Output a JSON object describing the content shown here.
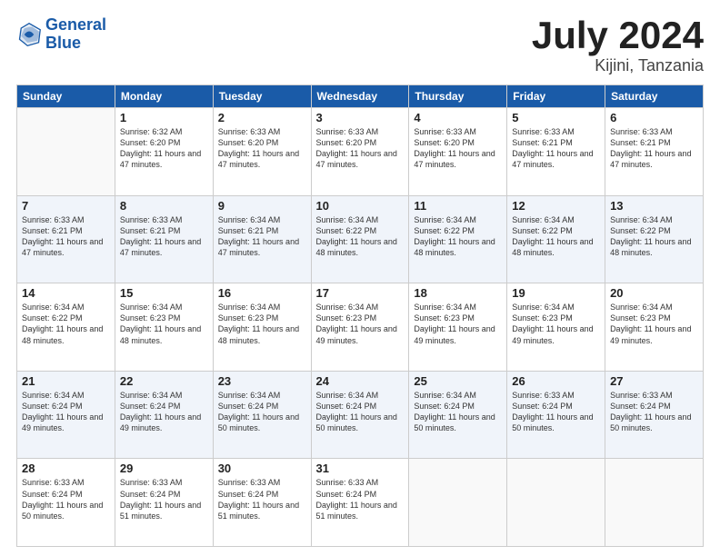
{
  "header": {
    "logo_line1": "General",
    "logo_line2": "Blue",
    "main_title": "July 2024",
    "sub_title": "Kijini, Tanzania"
  },
  "columns": [
    "Sunday",
    "Monday",
    "Tuesday",
    "Wednesday",
    "Thursday",
    "Friday",
    "Saturday"
  ],
  "weeks": [
    {
      "shade": "white",
      "days": [
        {
          "num": "",
          "info": ""
        },
        {
          "num": "1",
          "info": "Sunrise: 6:32 AM\nSunset: 6:20 PM\nDaylight: 11 hours\nand 47 minutes."
        },
        {
          "num": "2",
          "info": "Sunrise: 6:33 AM\nSunset: 6:20 PM\nDaylight: 11 hours\nand 47 minutes."
        },
        {
          "num": "3",
          "info": "Sunrise: 6:33 AM\nSunset: 6:20 PM\nDaylight: 11 hours\nand 47 minutes."
        },
        {
          "num": "4",
          "info": "Sunrise: 6:33 AM\nSunset: 6:20 PM\nDaylight: 11 hours\nand 47 minutes."
        },
        {
          "num": "5",
          "info": "Sunrise: 6:33 AM\nSunset: 6:21 PM\nDaylight: 11 hours\nand 47 minutes."
        },
        {
          "num": "6",
          "info": "Sunrise: 6:33 AM\nSunset: 6:21 PM\nDaylight: 11 hours\nand 47 minutes."
        }
      ]
    },
    {
      "shade": "shade",
      "days": [
        {
          "num": "7",
          "info": "Sunrise: 6:33 AM\nSunset: 6:21 PM\nDaylight: 11 hours\nand 47 minutes."
        },
        {
          "num": "8",
          "info": "Sunrise: 6:33 AM\nSunset: 6:21 PM\nDaylight: 11 hours\nand 47 minutes."
        },
        {
          "num": "9",
          "info": "Sunrise: 6:34 AM\nSunset: 6:21 PM\nDaylight: 11 hours\nand 47 minutes."
        },
        {
          "num": "10",
          "info": "Sunrise: 6:34 AM\nSunset: 6:22 PM\nDaylight: 11 hours\nand 48 minutes."
        },
        {
          "num": "11",
          "info": "Sunrise: 6:34 AM\nSunset: 6:22 PM\nDaylight: 11 hours\nand 48 minutes."
        },
        {
          "num": "12",
          "info": "Sunrise: 6:34 AM\nSunset: 6:22 PM\nDaylight: 11 hours\nand 48 minutes."
        },
        {
          "num": "13",
          "info": "Sunrise: 6:34 AM\nSunset: 6:22 PM\nDaylight: 11 hours\nand 48 minutes."
        }
      ]
    },
    {
      "shade": "white",
      "days": [
        {
          "num": "14",
          "info": "Sunrise: 6:34 AM\nSunset: 6:22 PM\nDaylight: 11 hours\nand 48 minutes."
        },
        {
          "num": "15",
          "info": "Sunrise: 6:34 AM\nSunset: 6:23 PM\nDaylight: 11 hours\nand 48 minutes."
        },
        {
          "num": "16",
          "info": "Sunrise: 6:34 AM\nSunset: 6:23 PM\nDaylight: 11 hours\nand 48 minutes."
        },
        {
          "num": "17",
          "info": "Sunrise: 6:34 AM\nSunset: 6:23 PM\nDaylight: 11 hours\nand 49 minutes."
        },
        {
          "num": "18",
          "info": "Sunrise: 6:34 AM\nSunset: 6:23 PM\nDaylight: 11 hours\nand 49 minutes."
        },
        {
          "num": "19",
          "info": "Sunrise: 6:34 AM\nSunset: 6:23 PM\nDaylight: 11 hours\nand 49 minutes."
        },
        {
          "num": "20",
          "info": "Sunrise: 6:34 AM\nSunset: 6:23 PM\nDaylight: 11 hours\nand 49 minutes."
        }
      ]
    },
    {
      "shade": "shade",
      "days": [
        {
          "num": "21",
          "info": "Sunrise: 6:34 AM\nSunset: 6:24 PM\nDaylight: 11 hours\nand 49 minutes."
        },
        {
          "num": "22",
          "info": "Sunrise: 6:34 AM\nSunset: 6:24 PM\nDaylight: 11 hours\nand 49 minutes."
        },
        {
          "num": "23",
          "info": "Sunrise: 6:34 AM\nSunset: 6:24 PM\nDaylight: 11 hours\nand 50 minutes."
        },
        {
          "num": "24",
          "info": "Sunrise: 6:34 AM\nSunset: 6:24 PM\nDaylight: 11 hours\nand 50 minutes."
        },
        {
          "num": "25",
          "info": "Sunrise: 6:34 AM\nSunset: 6:24 PM\nDaylight: 11 hours\nand 50 minutes."
        },
        {
          "num": "26",
          "info": "Sunrise: 6:33 AM\nSunset: 6:24 PM\nDaylight: 11 hours\nand 50 minutes."
        },
        {
          "num": "27",
          "info": "Sunrise: 6:33 AM\nSunset: 6:24 PM\nDaylight: 11 hours\nand 50 minutes."
        }
      ]
    },
    {
      "shade": "white",
      "days": [
        {
          "num": "28",
          "info": "Sunrise: 6:33 AM\nSunset: 6:24 PM\nDaylight: 11 hours\nand 50 minutes."
        },
        {
          "num": "29",
          "info": "Sunrise: 6:33 AM\nSunset: 6:24 PM\nDaylight: 11 hours\nand 51 minutes."
        },
        {
          "num": "30",
          "info": "Sunrise: 6:33 AM\nSunset: 6:24 PM\nDaylight: 11 hours\nand 51 minutes."
        },
        {
          "num": "31",
          "info": "Sunrise: 6:33 AM\nSunset: 6:24 PM\nDaylight: 11 hours\nand 51 minutes."
        },
        {
          "num": "",
          "info": ""
        },
        {
          "num": "",
          "info": ""
        },
        {
          "num": "",
          "info": ""
        }
      ]
    }
  ]
}
